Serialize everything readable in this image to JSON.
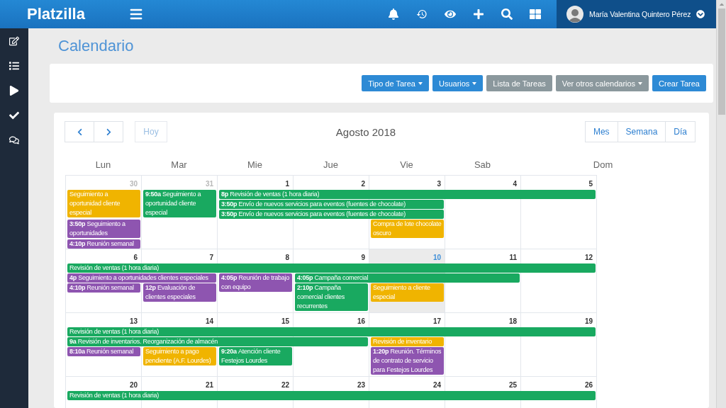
{
  "topbar": {
    "brand": "Platzilla",
    "user": {
      "name": "María Valentina Quintero Pérez"
    }
  },
  "page_title": "Calendario",
  "toolbar": {
    "buttons": [
      {
        "label": "Tipo de Tarea",
        "kind": "primary",
        "dropdown": true
      },
      {
        "label": "Usuarios",
        "kind": "primary",
        "dropdown": true
      },
      {
        "label": "Lista de Tareas",
        "kind": "secondary",
        "dropdown": false
      },
      {
        "label": "Ver otros calendarios",
        "kind": "secondary",
        "dropdown": true
      },
      {
        "label": "Crear Tarea",
        "kind": "primary",
        "dropdown": false
      }
    ]
  },
  "calendar": {
    "today_button": "Hoy",
    "title": "Agosto 2018",
    "views": [
      "Mes",
      "Semana",
      "Día"
    ],
    "weekdays": [
      "Lun",
      "Mar",
      "Mie",
      "Jue",
      "Vie",
      "Sab",
      "Dom"
    ],
    "weeks": [
      {
        "days": [
          {
            "number": "30",
            "muted": true,
            "today": false,
            "events": [
              {
                "kind": "single",
                "title": "Seguimiento a oportunidad cliente especial",
                "color": "#f0b400"
              },
              {
                "kind": "single",
                "time": "3:50p",
                "title": "Seguimiento a oportunidades",
                "color": "#8e55b0"
              },
              {
                "kind": "single",
                "time": "4:10p",
                "title": "Reunión semanal",
                "color": "#8e55b0"
              }
            ]
          },
          {
            "number": "31",
            "muted": true,
            "today": false,
            "events": [
              {
                "kind": "single",
                "time": "9:50a",
                "title": "Seguimiento a oportunidad cliente especial",
                "color": "#19a960"
              }
            ]
          },
          {
            "number": "1",
            "muted": false,
            "today": false,
            "events": [
              {
                "kind": "quintuple",
                "time": "8p",
                "title": "Revisión de ventas (1 hora diaria)",
                "color": "#19a960"
              },
              {
                "kind": "triple",
                "time": "3:50p",
                "title": "Envío de nuevos servicios para eventos (fuentes de chocolate)",
                "color": "#19a960"
              },
              {
                "kind": "triple",
                "time": "3:50p",
                "title": "Envío de nuevos servicios para eventos (fuentes de chocolate)",
                "color": "#19a960"
              }
            ]
          },
          {
            "number": "2",
            "muted": false,
            "today": false
          },
          {
            "number": "3",
            "muted": false,
            "today": false,
            "events": [
              {
                "kind": "single",
                "title": "Compra de lote chocolate oscuro",
                "color": "#f0b400"
              }
            ]
          },
          {
            "number": "4",
            "muted": false,
            "today": false
          },
          {
            "number": "5",
            "muted": false,
            "today": false
          }
        ]
      },
      {
        "days": [
          {
            "number": "6",
            "muted": false,
            "today": false,
            "events": [
              {
                "kind": "septuple",
                "title": "Revisión de ventas (1 hora diaria)",
                "color": "#19a960"
              },
              {
                "kind": "double",
                "time": "4p",
                "title": "Seguimiento a oportunidades clientes especiales",
                "color": "#8e55b0"
              },
              {
                "kind": "single",
                "time": "4:10p",
                "title": "Reunión semanal",
                "color": "#8e55b0"
              }
            ]
          },
          {
            "number": "7",
            "muted": false,
            "today": false,
            "events": [
              {
                "kind": "single",
                "time": "12p",
                "title": "Evaluación de clientes especiales",
                "color": "#8e55b0"
              }
            ]
          },
          {
            "number": "8",
            "muted": false,
            "today": false,
            "events": [
              {
                "kind": "single",
                "time": "4:05p",
                "title": "Reunión de trabajo con equipo",
                "color": "#8e55b0"
              }
            ]
          },
          {
            "number": "9",
            "muted": false,
            "today": false,
            "events": [
              {
                "kind": "triple",
                "time": "4:05p",
                "title": "Campaña comercial",
                "color": "#19a960"
              },
              {
                "kind": "single",
                "time": "2:10p",
                "title": "Campaña comercial clientes recurrentes",
                "color": "#19a960"
              }
            ]
          },
          {
            "number": "10",
            "muted": false,
            "today": true,
            "events": [
              {
                "kind": "single",
                "title": "Seguimiento a cliente especial",
                "color": "#f0b400"
              }
            ]
          },
          {
            "number": "11",
            "muted": false,
            "today": false
          },
          {
            "number": "12",
            "muted": false,
            "today": false
          }
        ]
      },
      {
        "days": [
          {
            "number": "13",
            "muted": false,
            "today": false,
            "events": [
              {
                "kind": "septuple",
                "title": "Revisión de ventas (1 hora diaria)",
                "color": "#19a960"
              },
              {
                "kind": "quadruple",
                "time": "9a",
                "title": "Revisión de inventarios. Reorganización de almacén",
                "color": "#19a960"
              },
              {
                "kind": "single",
                "time": "8:10a",
                "title": "Reunión semanal",
                "color": "#8e55b0"
              }
            ]
          },
          {
            "number": "14",
            "muted": false,
            "today": false,
            "events": [
              {
                "kind": "single",
                "title": "Seguimiento a pago pendiente (A.F. Lourdes)",
                "color": "#f0b400"
              }
            ]
          },
          {
            "number": "15",
            "muted": false,
            "today": false,
            "events": [
              {
                "kind": "single",
                "time": "9:20a",
                "title": "Atención cliente Festejos Lourdes",
                "color": "#19a960"
              }
            ]
          },
          {
            "number": "16",
            "muted": false,
            "today": false
          },
          {
            "number": "17",
            "muted": false,
            "today": false,
            "events": [
              {
                "kind": "single",
                "title": "Revisión de inventario",
                "color": "#f0b400"
              },
              {
                "kind": "single",
                "time": "1:20p",
                "title": "Reunión. Términos de contrato de servicio para Festejos Lourdes",
                "color": "#8e55b0"
              }
            ]
          },
          {
            "number": "18",
            "muted": false,
            "today": false
          },
          {
            "number": "19",
            "muted": false,
            "today": false
          }
        ]
      },
      {
        "days": [
          {
            "number": "20",
            "muted": false,
            "today": false,
            "events": [
              {
                "kind": "septuple",
                "title": "Revisión de ventas (1 hora diaria)",
                "color": "#19a960"
              }
            ]
          },
          {
            "number": "21",
            "muted": false,
            "today": false
          },
          {
            "number": "22",
            "muted": false,
            "today": false
          },
          {
            "number": "23",
            "muted": false,
            "today": false
          },
          {
            "number": "24",
            "muted": false,
            "today": false
          },
          {
            "number": "25",
            "muted": false,
            "today": false
          },
          {
            "number": "26",
            "muted": false,
            "today": false
          }
        ]
      }
    ]
  }
}
